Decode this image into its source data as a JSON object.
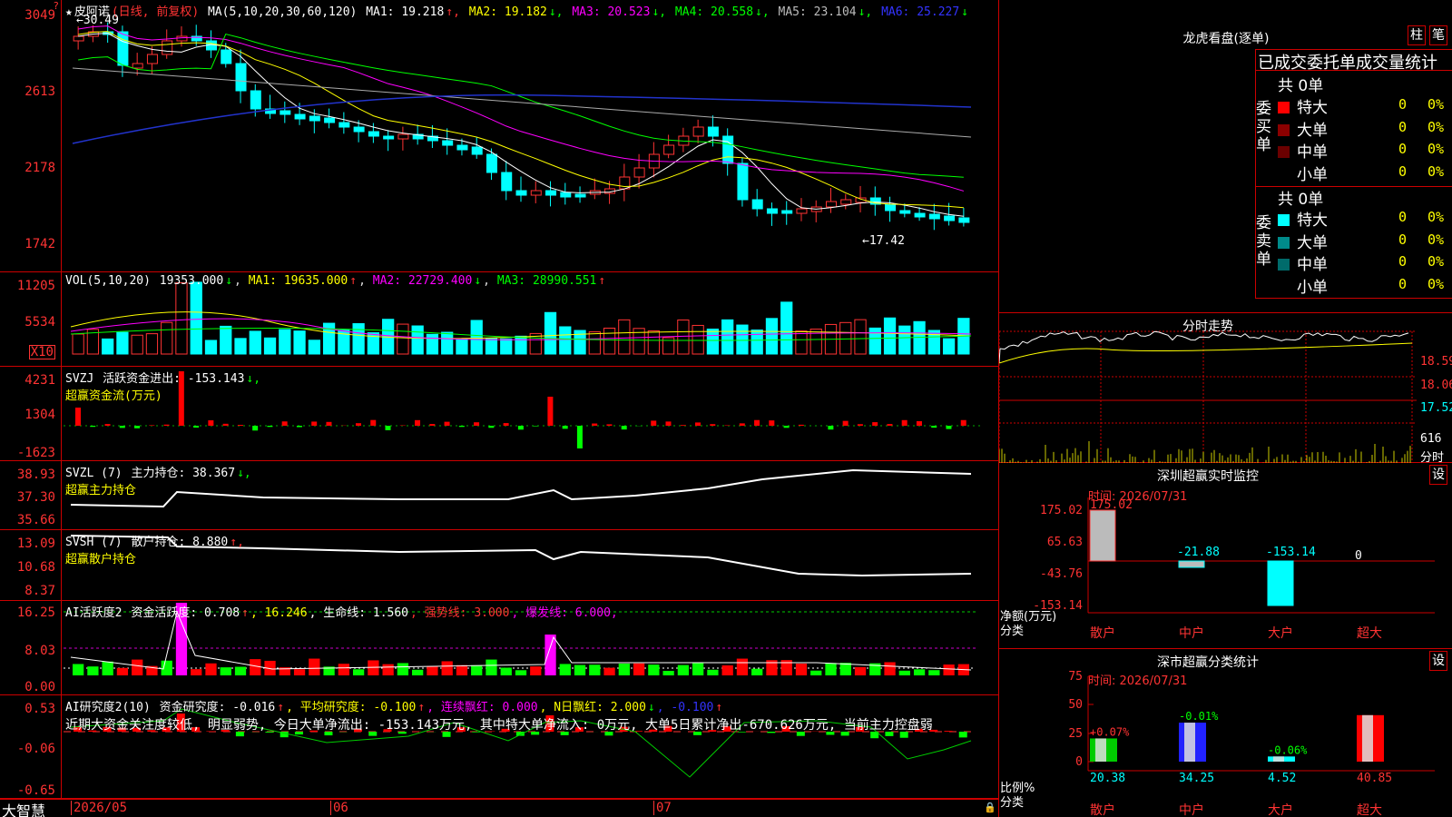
{
  "stock": {
    "name": "皮阿诺",
    "period": "(日线, 前复权)",
    "star": "★"
  },
  "main": {
    "ma_label": "MA(5,10,20,30,60,120)",
    "ma": [
      {
        "label": "MA1:",
        "value": "19.218",
        "arrow": "↑",
        "color": "#ffffff"
      },
      {
        "label": "MA2:",
        "value": "19.182",
        "arrow": "↓",
        "color": "#ffff00"
      },
      {
        "label": "MA3:",
        "value": "20.523",
        "arrow": "↓",
        "color": "#ff00ff"
      },
      {
        "label": "MA4:",
        "value": "20.558",
        "arrow": "↓",
        "color": "#00ff00"
      },
      {
        "label": "MA5:",
        "value": "23.104",
        "arrow": "↓",
        "color": "#bbbbbb"
      },
      {
        "label": "MA6:",
        "value": "25.227",
        "arrow": "↓",
        "color": "#3333ff"
      }
    ],
    "yticks": [
      "3049",
      "2613",
      "2178",
      "1742"
    ],
    "high_label": "30.49",
    "low_label": "17.42"
  },
  "vol": {
    "header": "VOL(5,10,20)",
    "value": "19353.000",
    "arrow": "↓",
    "ma1": "MA1: 19635.000",
    "ma1_arrow": "↑",
    "ma2": "MA2: 22729.400",
    "ma2_arrow": "↓",
    "ma3": "MA3: 28990.551",
    "ma3_arrow": "↑",
    "yticks": [
      "11205",
      "5534"
    ],
    "unit": "X10"
  },
  "svzj": {
    "header": "SVZJ",
    "label": "活跃资金进出: -153.143",
    "arrow": "↓,",
    "sub": "超赢资金流(万元)",
    "yticks": [
      "4231",
      "1304",
      "-1623"
    ]
  },
  "svzl": {
    "header": "SVZL (7)",
    "label": "主力持仓: 38.367",
    "arrow": "↓,",
    "sub": "超赢主力持仓",
    "yticks": [
      "38.93",
      "37.30",
      "35.66"
    ]
  },
  "svsh": {
    "header": "SVSH (7)",
    "label": "散户持仓: 8.880",
    "arrow": "↑,",
    "sub": "超赢散户持仓",
    "yticks": [
      "13.09",
      "10.68",
      "8.37"
    ]
  },
  "ai1": {
    "header": "AI活跃度2",
    "label": "资金活跃度: 0.708",
    "arrow": "↑",
    "v2": ", 16.246",
    "life": ", 生命线: 1.560",
    "strong": ", 强势线: 3.000",
    "burst": ", 爆发线: 6.000,",
    "yticks": [
      "16.25",
      "8.03",
      "0.00"
    ]
  },
  "ai2": {
    "header": "AI研究度2(10)",
    "label": "资金研究度: -0.016",
    "arrow": "↑",
    "avg": ", 平均研究度: -0.100",
    "avg_arrow": "↑",
    "red": ", 连续飘红: 0.000",
    "n": ", N日飘红: 2.000",
    "n_arrow": "↓",
    "last": ", -0.100",
    "last_arrow": "↑",
    "text": "近期大资金关注度较低, 明显弱势, 今日大单净流出: -153.143万元, 其中特大单净流入: 0万元, 大单5日累计净出-670.626万元, 当前主力控盘弱",
    "yticks": [
      "0.53",
      "-0.06",
      "-0.65"
    ]
  },
  "xaxis": {
    "logo": "大智慧",
    "labels": [
      "2026/05",
      "06",
      "07"
    ]
  },
  "lhb": {
    "title": "龙虎看盘(逐单)",
    "btn1": "柱",
    "btn2": "笔",
    "sub": "已成交委托单成交量统计",
    "buy": {
      "label": "委买单",
      "total": "共 0单",
      "rows": [
        {
          "name": "特大",
          "count": "0",
          "pct": "0%",
          "color": "#ff0000"
        },
        {
          "name": "大单",
          "count": "0",
          "pct": "0%",
          "color": "#8b0000"
        },
        {
          "name": "中单",
          "count": "0",
          "pct": "0%",
          "color": "#6b0000"
        },
        {
          "name": "小单",
          "count": "0",
          "pct": "0%",
          "color": "#000000"
        }
      ]
    },
    "sell": {
      "label": "委卖单",
      "total": "共 0单",
      "rows": [
        {
          "name": "特大",
          "count": "0",
          "pct": "0%",
          "color": "#00ffff"
        },
        {
          "name": "大单",
          "count": "0",
          "pct": "0%",
          "color": "#008b8b"
        },
        {
          "name": "中单",
          "count": "0",
          "pct": "0%",
          "color": "#006b6b"
        },
        {
          "name": "小单",
          "count": "0",
          "pct": "0%",
          "color": "#000000"
        }
      ]
    }
  },
  "fenshi": {
    "title": "分时走势",
    "yticks": [
      "18.59",
      "18.06",
      "17.52"
    ],
    "vol": "616",
    "unit": "分时"
  },
  "monitor": {
    "title": "深圳超赢实时监控",
    "btn": "设",
    "time": "时间: 2026/07/31",
    "yticks": [
      "175.02",
      "65.63",
      "-43.76",
      "-153.14"
    ],
    "ylabel": "净额(万元)",
    "xlabel": "分类",
    "cats": [
      "散户",
      "中户",
      "大户",
      "超大"
    ],
    "values": [
      "175.02",
      "-21.88",
      "-153.14",
      "0"
    ]
  },
  "stat": {
    "title": "深市超赢分类统计",
    "btn": "设",
    "time": "时间: 2026/07/31",
    "yticks": [
      "75",
      "50",
      "25",
      "0"
    ],
    "ylabel": "比例%",
    "xlabel": "分类",
    "cats": [
      "散户",
      "中户",
      "大户",
      "超大"
    ],
    "values": [
      "20.38",
      "34.25",
      "4.52",
      "40.85"
    ],
    "changes": [
      "+0.07%",
      "-0.01%",
      "-0.06%",
      ""
    ]
  }
}
